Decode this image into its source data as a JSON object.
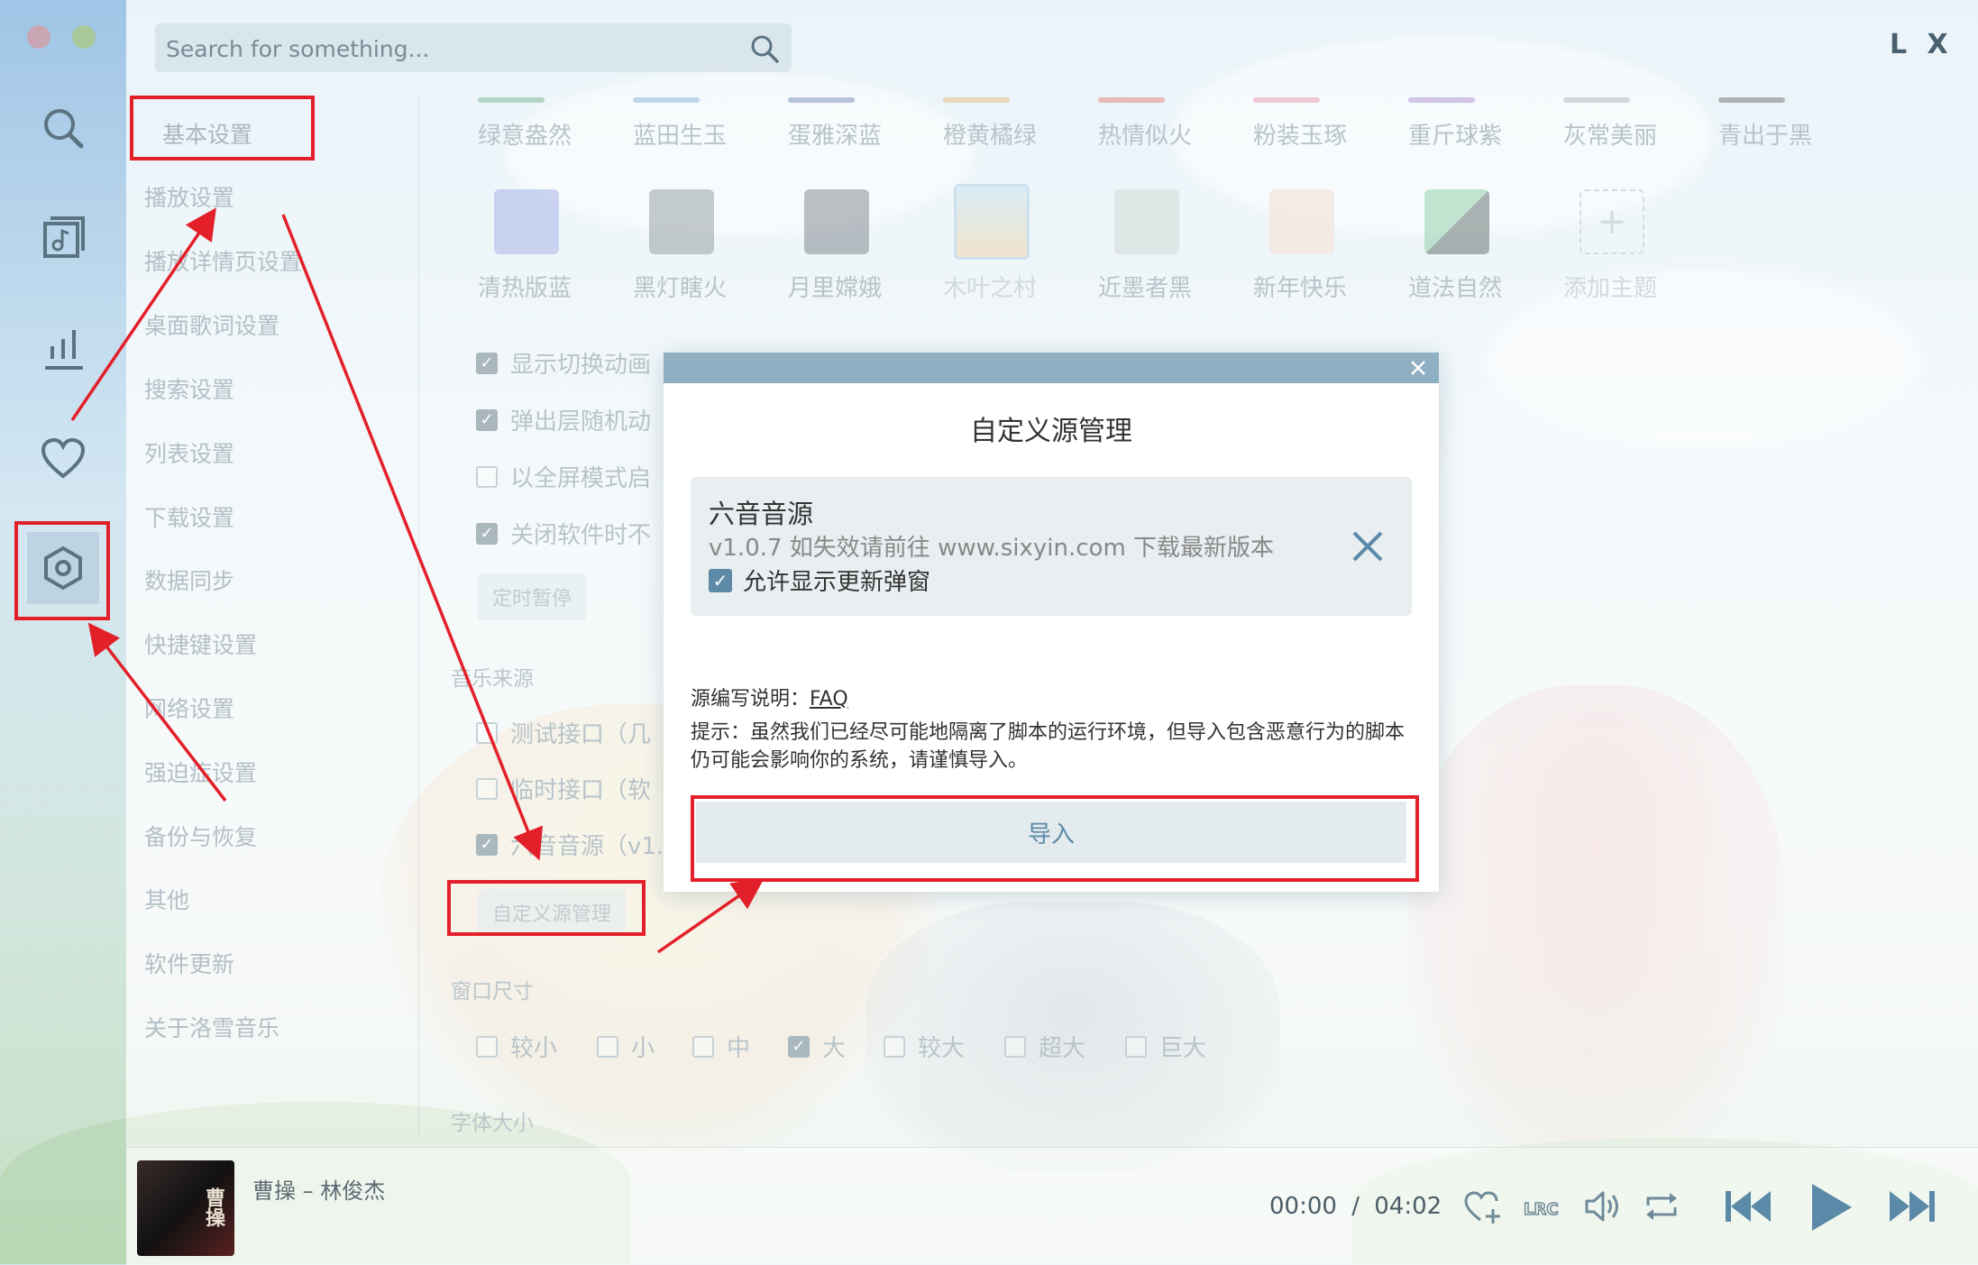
{
  "search": {
    "placeholder": "Search for something..."
  },
  "brand": "L X",
  "nav_items": [
    "基本设置",
    "播放设置",
    "播放详情页设置",
    "桌面歌词设置",
    "搜索设置",
    "列表设置",
    "下载设置",
    "数据同步",
    "快捷键设置",
    "网络设置",
    "强迫症设置",
    "备份与恢复",
    "其他",
    "软件更新",
    "关于洛雪音乐"
  ],
  "themes_row1": [
    "绿意盎然",
    "蓝田生玉",
    "蛋雅深蓝",
    "橙黄橘绿",
    "热情似火",
    "粉装玉琢",
    "重斤球紫",
    "灰常美丽",
    "青出于黑"
  ],
  "themes_row2": [
    "清热版蓝",
    "黑灯瞎火",
    "月里嫦娥",
    "木叶之村",
    "近墨者黑",
    "新年快乐",
    "道法自然",
    "添加主题"
  ],
  "colors": {
    "row1": [
      "#4b9a6b",
      "#5a8ec8",
      "#3f5d9a",
      "#e0a040",
      "#e04e3a",
      "#e06a8e",
      "#8a5ec0",
      "#8d98a0",
      "#3a3a3a"
    ],
    "row2": [
      "#a7b5e8",
      "#4d5a58",
      "#2f3440",
      "#b9d4e8",
      "#cfd6d2",
      "#f3e4dc",
      "#3fae6a",
      "#ffffff"
    ],
    "accent": "#5a8aa8",
    "annotation": "#e3202a"
  },
  "general_options": [
    {
      "label": "显示切换动画",
      "checked": true
    },
    {
      "label": "弹出层随机动",
      "checked": true
    },
    {
      "label": "以全屏模式启",
      "checked": false
    },
    {
      "label": "关闭软件时不",
      "checked": true
    }
  ],
  "timer_button": "定时暂停",
  "music_source": {
    "title": "音乐来源",
    "options": [
      {
        "label": "测试接口（几",
        "checked": false
      },
      {
        "label": "临时接口（软",
        "checked": false
      },
      {
        "label": "六音音源（v1.",
        "checked": true
      }
    ],
    "manage_button": "自定义源管理"
  },
  "window_size": {
    "title": "窗口尺寸",
    "options": [
      {
        "label": "较小",
        "checked": false
      },
      {
        "label": "小",
        "checked": false
      },
      {
        "label": "中",
        "checked": false
      },
      {
        "label": "大",
        "checked": true
      },
      {
        "label": "较大",
        "checked": false
      },
      {
        "label": "超大",
        "checked": false
      },
      {
        "label": "巨大",
        "checked": false
      }
    ]
  },
  "font_size_title": "字体大小",
  "modal": {
    "title": "自定义源管理",
    "source_name": "六音音源",
    "source_desc": "v1.0.7 如失效请前往 www.sixyin.com 下载最新版本",
    "allow_update_label": "允许显示更新弹窗",
    "allow_update_checked": true,
    "faq_prefix": "源编写说明：",
    "faq_link": "FAQ",
    "tip": "提示：虽然我们已经尽可能地隔离了脚本的运行环境，但导入包含恶意行为的脚本仍可能会影响你的系统，请谨慎导入。",
    "import_button": "导入"
  },
  "player": {
    "cover_text": "曹操",
    "song": "曹操 – 林俊杰",
    "current_time": "00:00",
    "separator": "/",
    "duration": "04:02"
  },
  "icons": {
    "rail": [
      "search-icon",
      "music-library-icon",
      "chart-icon",
      "heart-icon",
      "settings-icon"
    ],
    "player": [
      "favorite-add-icon",
      "lyrics-icon",
      "volume-icon",
      "repeat-icon",
      "previous-icon",
      "play-icon",
      "next-icon"
    ]
  }
}
